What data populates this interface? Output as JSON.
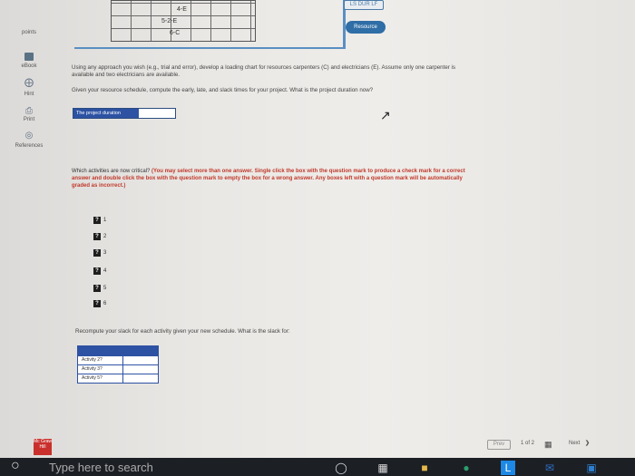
{
  "rail": {
    "points_label": "points",
    "ebook_label": "eBook",
    "hint_label": "Hint",
    "print_label": "Print",
    "references_label": "References"
  },
  "top_panel": {
    "task_labels": [
      "4-E",
      "5-2-E",
      "6-C"
    ],
    "ls_button": "LS DUR LF",
    "resource_button": "Resource"
  },
  "main": {
    "instruction_1": "Using any approach you wish (e.g., trial and error), develop a loading chart for resources carpenters (C) and electricians (E). Assume only one carpenter is available and two electricians are available.",
    "instruction_2": "Given your resource schedule, compute the early, late, and slack times for your project. What is the project duration now?",
    "duration_label": "The project duration",
    "duration_value": "",
    "critical_question": "Which activities are now critical?",
    "critical_instructions": "(You may select more than one answer. Single click the box with the question mark to produce a check mark for a correct answer and double click the box with the question mark to empty the box for a wrong answer. Any boxes left with a question mark will be automatically graded as incorrect.)",
    "activities": [
      {
        "mark": "?",
        "num": "1"
      },
      {
        "mark": "?",
        "num": "2"
      },
      {
        "mark": "?",
        "num": "3"
      },
      {
        "mark": "?",
        "num": "4"
      },
      {
        "mark": "?",
        "num": "5"
      },
      {
        "mark": "?",
        "num": "6"
      }
    ],
    "slack_question": "Recompute your slack for each activity given your new schedule. What is the slack for:",
    "slack_rows": [
      "Activity 2?",
      "Activity 3?",
      "Activity 5?"
    ]
  },
  "footer": {
    "logo": "Mc Graw Hill",
    "prev": "Prev",
    "pager": "1 of 2",
    "next": "Next"
  },
  "taskbar": {
    "search_placeholder": "Type here to search"
  }
}
